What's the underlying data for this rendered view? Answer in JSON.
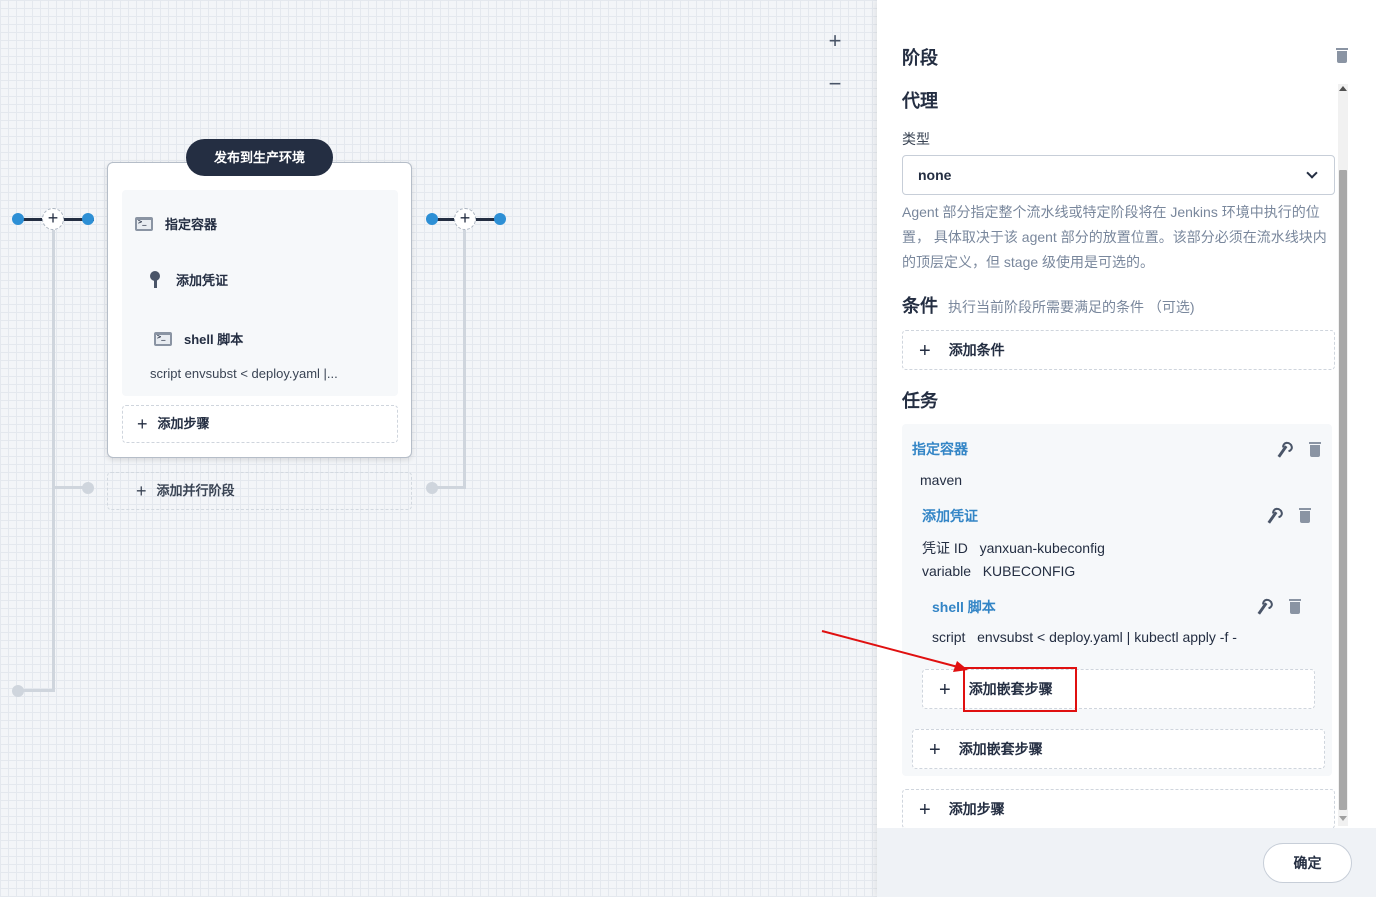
{
  "canvas": {
    "zoom_in": "+",
    "zoom_out": "−",
    "stage": {
      "title": "发布到生产环境",
      "steps": [
        {
          "label": "指定容器",
          "icon": "terminal-icon"
        },
        {
          "label": "添加凭证",
          "icon": "key-icon"
        },
        {
          "label": "shell 脚本",
          "icon": "terminal-icon"
        }
      ],
      "script_preview": "script   envsubst < deploy.yaml |...",
      "add_step": "添加步骤"
    },
    "add_parallel": "添加并行阶段",
    "plus": "+"
  },
  "panel": {
    "stage_heading": "阶段",
    "agent_heading": "代理",
    "type_label": "类型",
    "type_value": "none",
    "agent_desc": "Agent 部分指定整个流水线或特定阶段将在 Jenkins 环境中执行的位置， 具体取决于该 agent 部分的放置位置。该部分必须在流水线块内的顶层定义，但 stage 级使用是可选的。",
    "condition_heading": "条件",
    "condition_desc": "执行当前阶段所需要满足的条件 （可选)",
    "add_condition": "添加条件",
    "tasks_heading": "任务",
    "tasks": {
      "container": {
        "label": "指定容器",
        "value": "maven"
      },
      "credential": {
        "label": "添加凭证",
        "id_label": "凭证 ID",
        "id_value": "yanxuan-kubeconfig",
        "var_label": "variable",
        "var_value": "KUBECONFIG"
      },
      "shell": {
        "label": "shell 脚本",
        "script_label": "script",
        "script_value": "envsubst < deploy.yaml | kubectl apply -f -"
      },
      "add_nested_inner": "添加嵌套步骤",
      "add_nested_outer": "添加嵌套步骤"
    },
    "add_step": "添加步骤",
    "ok": "确定",
    "plus": "+"
  },
  "colors": {
    "accent": "#3385c6",
    "annotation": "#e01010",
    "dark": "#242e42"
  }
}
